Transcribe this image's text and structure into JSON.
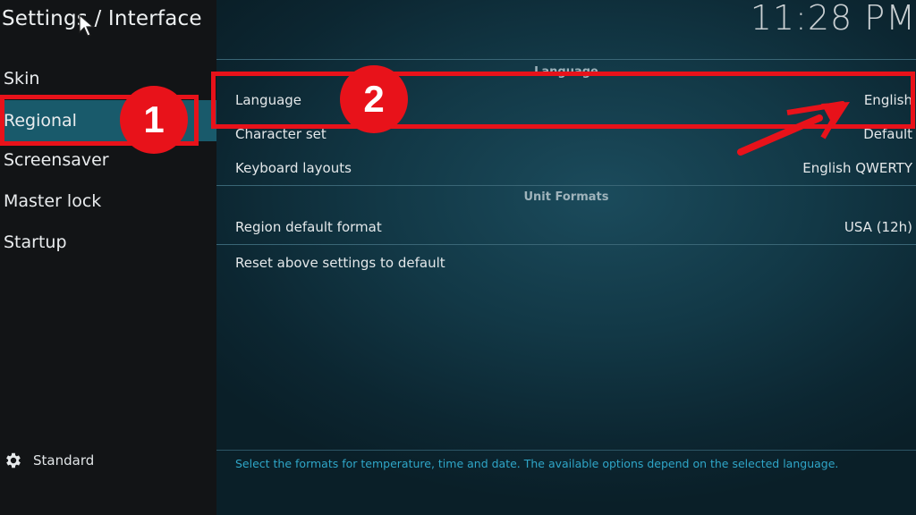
{
  "header": {
    "title": "Settings / Interface",
    "clock": "11:28 PM"
  },
  "sidebar": {
    "items": [
      {
        "label": "Skin"
      },
      {
        "label": "Regional",
        "selected": true
      },
      {
        "label": "Screensaver"
      },
      {
        "label": "Master lock"
      },
      {
        "label": "Startup"
      }
    ],
    "level_icon": "gear-icon",
    "level_label": "Standard"
  },
  "settings": {
    "language_group_title": "Language",
    "rows": [
      {
        "label": "Language",
        "value": "English"
      },
      {
        "label": "Character set",
        "value": "Default"
      },
      {
        "label": "Keyboard layouts",
        "value": "English QWERTY"
      }
    ],
    "unit_group_title": "Unit Formats",
    "unit_rows": [
      {
        "label": "Region default format",
        "value": "USA (12h)"
      }
    ],
    "reset_label": "Reset above settings to default"
  },
  "hint": "Select the formats for temperature, time and date. The available options depend on the selected language.",
  "annotations": {
    "badge_1": "1",
    "badge_2": "2",
    "color": "#e8121a"
  }
}
